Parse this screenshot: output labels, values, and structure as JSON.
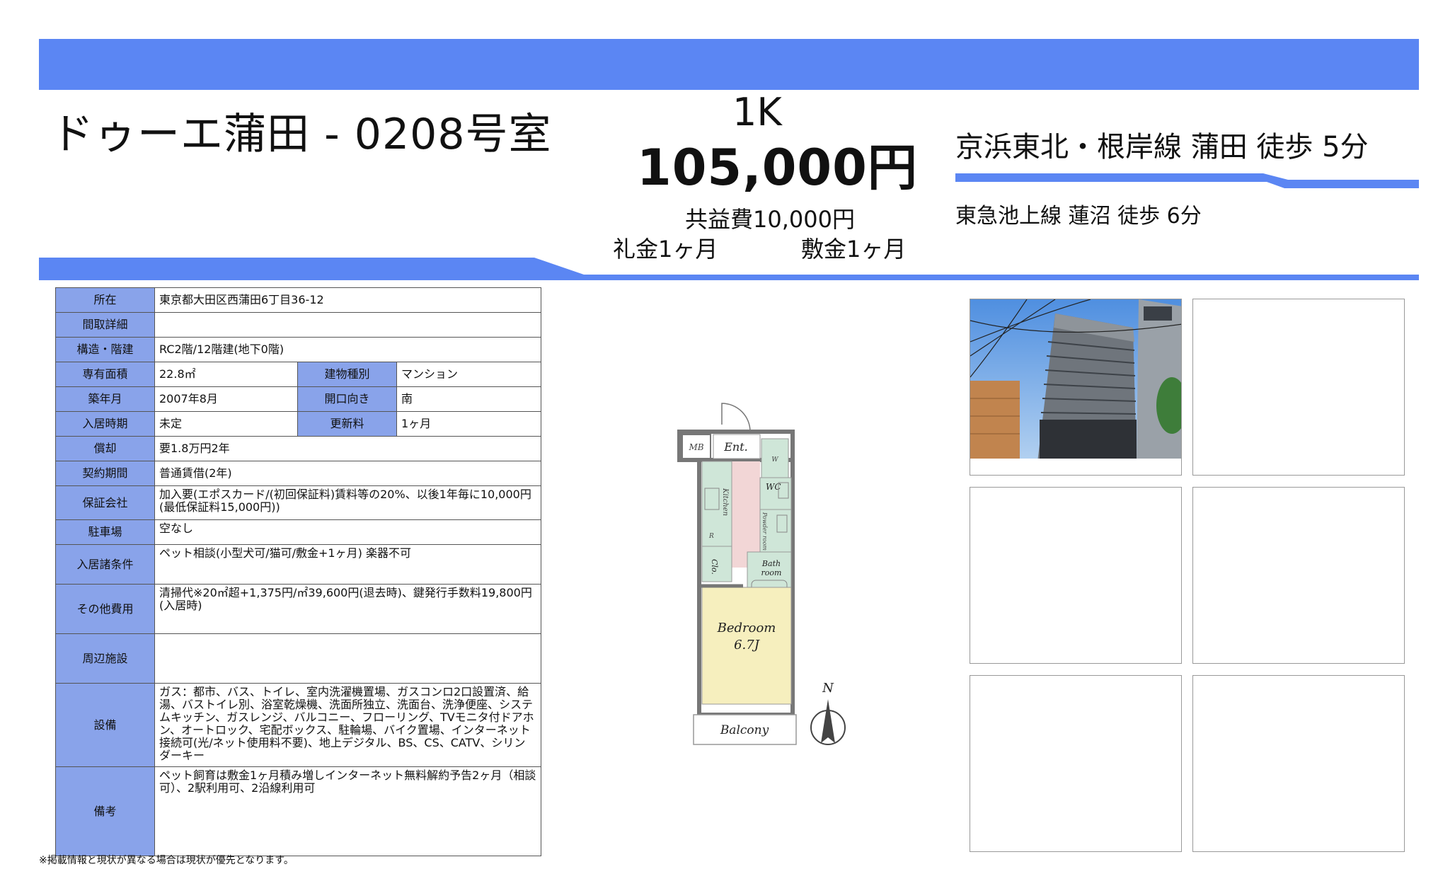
{
  "header": {
    "property_title": "ドゥーエ蒲田 - 0208号室",
    "layout_type": "1K",
    "rent": "105,000円",
    "management_fee": "共益費10,000円",
    "key_money": "礼金1ヶ月",
    "deposit": "敷金1ヶ月",
    "station_primary": "京浜東北・根岸線 蒲田 徒歩 5分",
    "station_secondary": "東急池上線 蓮沼 徒歩 6分"
  },
  "details": {
    "location_label": "所在",
    "location_value": "東京都大田区西蒲田6丁目36-12",
    "layout_detail_label": "間取詳細",
    "layout_detail_value": "",
    "structure_label": "構造・階建",
    "structure_value": "RC2階/12階建(地下0階)",
    "area_label": "専有面積",
    "area_value": "22.8㎡",
    "building_type_label": "建物種別",
    "building_type_value": "マンション",
    "built_label": "築年月",
    "built_value": "2007年8月",
    "orientation_label": "開口向き",
    "orientation_value": "南",
    "move_in_label": "入居時期",
    "move_in_value": "未定",
    "renewal_fee_label": "更新料",
    "renewal_fee_value": "1ヶ月",
    "deduction_label": "償却",
    "deduction_value": "要1.8万円2年",
    "contract_label": "契約期間",
    "contract_value": "普通賃借(2年)",
    "guarantor_label": "保証会社",
    "guarantor_value": "加入要(エポスカード/(初回保証料)賃料等の20%、以後1年毎に10,000円(最低保証料15,000円))",
    "parking_label": "駐車場",
    "parking_value": "空なし",
    "conditions_label": "入居諸条件",
    "conditions_value": "ペット相談(小型犬可/猫可/敷金+1ヶ月) 楽器不可",
    "other_costs_label": "その他費用",
    "other_costs_value": "清掃代※20㎡超+1,375円/㎡39,600円(退去時)、鍵発行手数料19,800円(入居時)",
    "nearby_label": "周辺施設",
    "nearby_value": "",
    "equipment_label": "設備",
    "equipment_value": "ガス：都市、バス、トイレ、室内洗濯機置場、ガスコンロ2口設置済、給湯、バストイレ別、浴室乾燥機、洗面所独立、洗面台、洗浄便座、システムキッチン、ガスレンジ、バルコニー、フローリング、TVモニタ付ドアホン、オートロック、宅配ボックス、駐輪場、バイク置場、インターネット接続可(光/ネット使用料不要)、地上デジタル、BS、CS、CATV、シリンダーキー",
    "remarks_label": "備考",
    "remarks_value": "ペット飼育は敷金1ヶ月積み増しインターネット無料解約予告2ヶ月（相談可）、2駅利用可、2沿線利用可"
  },
  "floorplan": {
    "mb": "MB",
    "ent": "Ent.",
    "wc": "WC",
    "kitchen": "Kitchen",
    "powder_room": "Powder room",
    "bath_room_1": "Bath",
    "bath_room_2": "room",
    "clo": "Clo.",
    "bedroom": "Bedroom",
    "bedroom_size": "6.7J",
    "balcony": "Balcony",
    "north": "N",
    "r_mark": "R",
    "w_mark": "W"
  },
  "colors": {
    "accent": "#5b86f3",
    "table_header": "#89a3ea"
  },
  "footnote": "※掲載情報と現状が異なる場合は現状が優先となります。"
}
